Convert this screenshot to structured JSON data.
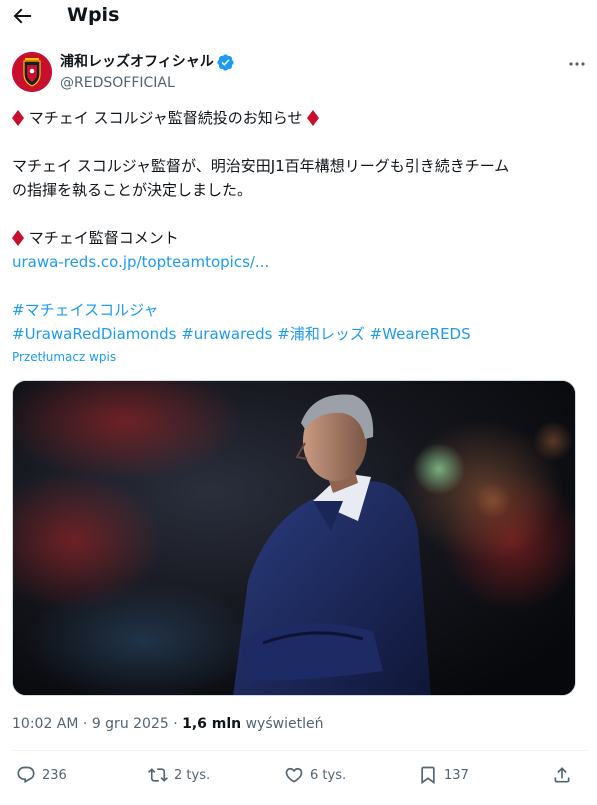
{
  "header": {
    "title": "Wpis"
  },
  "author": {
    "name": "浦和レッズオフィシャル",
    "handle": "@REDSOFFICIAL"
  },
  "tweet": {
    "title": "マチェイ スコルジャ監督続投のお知らせ",
    "body_line1": "マチェイ スコルジャ監督が、明治安田J1百年構想リーグも引き続きチーム",
    "body_line2": "の指揮を執ることが決定しました。",
    "comment_label": "マチェイ監督コメント",
    "link": "urawa-reds.co.jp/topteamtopics/...",
    "hashtag_main": "#マチェイスコルジャ",
    "hashtags": [
      "#UrawaRedDiamonds",
      "#urawareds",
      "#浦和レッズ",
      "#WeareREDS"
    ]
  },
  "translate_label": "Przetłumacz wpis",
  "meta": {
    "time": "10:02 AM",
    "separator": " · ",
    "date": "9 gru 2025",
    "views_count": "1,6 mln",
    "views_label": "wyświetleń"
  },
  "actions": {
    "replies": "236",
    "reposts": "2 tys.",
    "likes": "6 tys.",
    "bookmarks": "137"
  },
  "colors": {
    "accent": "#1d9bf0",
    "diamond": "#c8102e",
    "secondary_text": "#536471"
  }
}
